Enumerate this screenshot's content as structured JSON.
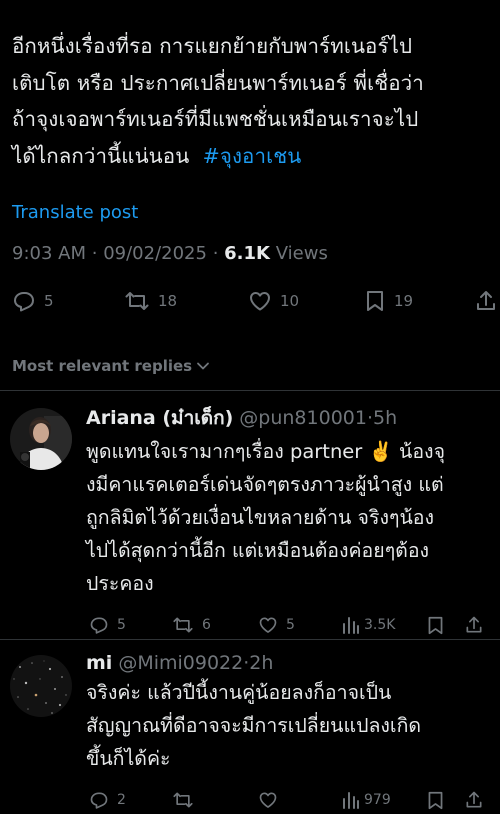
{
  "tweet": {
    "lines": [
      "อีกหนึ่งเรื่องที่รอ การแยกย้ายกับพาร์ทเนอร์ไป",
      "เติบโต หรือ ประกาศเปลี่ยนพาร์ทเนอร์ พี่เชื่อว่า",
      "ถ้าจุงเจอพาร์ทเนอร์ที่มีแพชชั่นเหมือนเราจะไป"
    ],
    "last_line_text": "ได้ไกลกว่านี้แน่นอน",
    "hashtag": "#จุงอาเชน",
    "translate_label": "Translate post",
    "time": "9:03 AM",
    "separator": "·",
    "date": "09/02/2025",
    "views_count": "6.1K",
    "views_label": "Views",
    "replies": "5",
    "reposts": "18",
    "likes": "10",
    "bookmarks": "19"
  },
  "filter": {
    "label": "Most relevant replies"
  },
  "replies": [
    {
      "name": "Ariana (ม๋าเด็ก)",
      "handle": "@pun810001",
      "time": "5h",
      "lines": [
        "พูดแทนใจเรามากๆเรื่อง partner ✌️ น้องจุ",
        "งมีคาแรคเตอร์เด่นจัดๆตรงภาวะผู้นำสูง แต่",
        "ถูกลิมิตไว้ด้วยเงื่อนไขหลายด้าน จริงๆน้อง",
        "ไปได้สุดกว่านี้อีก แต่เหมือนต้องค่อยๆต้อง",
        "ประคอง"
      ],
      "replies": "5",
      "reposts": "6",
      "likes": "5",
      "views": "3.5K"
    },
    {
      "name": "mi",
      "handle": "@Mimi09022",
      "time": "2h",
      "lines": [
        "จริงค่ะ  แล้วปีนี้งานคู่น้อยลงก็อาจเป็น",
        "สัญญาณที่ดีอาจจะมีการเปลี่ยนแปลงเกิด",
        "ขึ้นก็ได้ค่ะ"
      ],
      "replies": "2",
      "reposts": "",
      "likes": "",
      "views": "979"
    }
  ],
  "colors": {
    "accent": "#1d9bf0",
    "secondary_text": "#71767b",
    "background": "#000000",
    "divider": "#2f3336"
  }
}
